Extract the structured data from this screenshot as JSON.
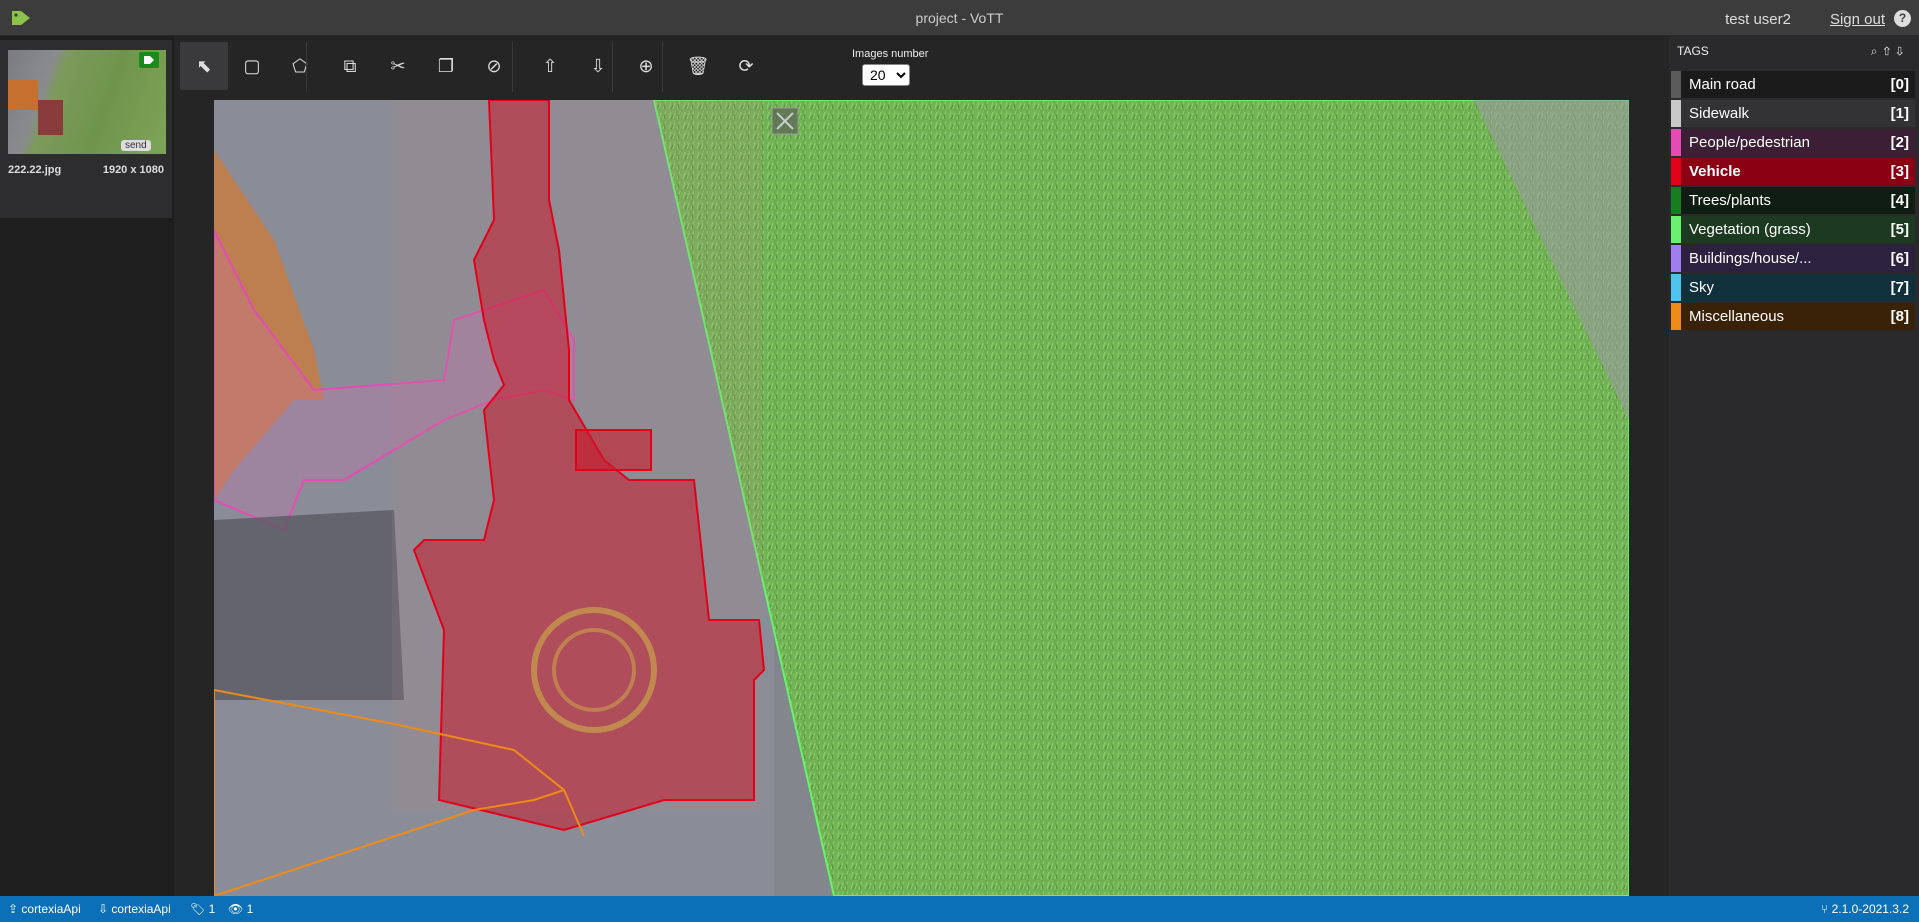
{
  "app": {
    "title": "project - VoTT",
    "user": "test user2",
    "signout": "Sign out",
    "help_icon": "question-circle-icon",
    "logo_icon": "tag-logo-icon"
  },
  "thumbnails": [
    {
      "filename": "222.22.jpg",
      "dims": "1920 x 1080",
      "badge": "send"
    }
  ],
  "toolbar": {
    "tools": [
      {
        "name": "select-tool",
        "icon": "pointer-icon",
        "glyph": "⬉"
      },
      {
        "name": "rectangle-tool",
        "icon": "rectangle-icon",
        "glyph": "▢"
      },
      {
        "name": "polygon-tool",
        "icon": "polygon-icon",
        "glyph": "⬠"
      },
      {
        "name": "copy-tool",
        "icon": "copy-icon",
        "glyph": "⧉"
      },
      {
        "name": "cut-tool",
        "icon": "scissors-icon",
        "glyph": "✂"
      },
      {
        "name": "paste-tool",
        "icon": "paste-icon",
        "glyph": "❐"
      },
      {
        "name": "clear-tool",
        "icon": "ban-icon",
        "glyph": "⊘"
      },
      {
        "name": "previous-image",
        "icon": "arrow-up-circle-icon",
        "glyph": "⇧"
      },
      {
        "name": "next-image",
        "icon": "arrow-down-circle-icon",
        "glyph": "⇩"
      },
      {
        "name": "zoom-tool",
        "icon": "zoom-in-icon",
        "glyph": "⊕"
      },
      {
        "name": "delete-tool",
        "icon": "trash-icon",
        "glyph": "🗑"
      },
      {
        "name": "refresh-tool",
        "icon": "refresh-icon",
        "glyph": "⟳"
      }
    ],
    "images_number_label": "Images number",
    "images_number_value": "20"
  },
  "tags": {
    "header": "TAGS",
    "header_icons": [
      "search-icon",
      "arrow-up-icon",
      "arrow-down-icon"
    ],
    "items": [
      {
        "label": "Main road",
        "key": "[0]",
        "color": "#5a5a5a",
        "bg": "#1b1b1b"
      },
      {
        "label": "Sidewalk",
        "key": "[1]",
        "color": "#c8c8c8",
        "bg": "#333336"
      },
      {
        "label": "People/pedestrian",
        "key": "[2]",
        "color": "#e54bb4",
        "bg": "#3c1e35"
      },
      {
        "label": "Vehicle",
        "key": "[3]",
        "color": "#e3001b",
        "bg": "#8b0012"
      },
      {
        "label": "Trees/plants",
        "key": "[4]",
        "color": "#177d21",
        "bg": "#0f1d12"
      },
      {
        "label": "Vegetation (grass)",
        "key": "[5]",
        "color": "#67f26e",
        "bg": "#1c3a1f"
      },
      {
        "label": "Buildings/house/...",
        "key": "[6]",
        "color": "#a07df0",
        "bg": "#2c2240"
      },
      {
        "label": "Sky",
        "key": "[7]",
        "color": "#4cc3f0",
        "bg": "#10303c"
      },
      {
        "label": "Miscellaneous",
        "key": "[8]",
        "color": "#ef8a17",
        "bg": "#3a2208"
      }
    ]
  },
  "statusbar": {
    "source": "cortexiaApi",
    "target": "cortexiaApi",
    "tag_count": "1",
    "visited_count": "1",
    "version": "2.1.0-2021.3.2"
  }
}
